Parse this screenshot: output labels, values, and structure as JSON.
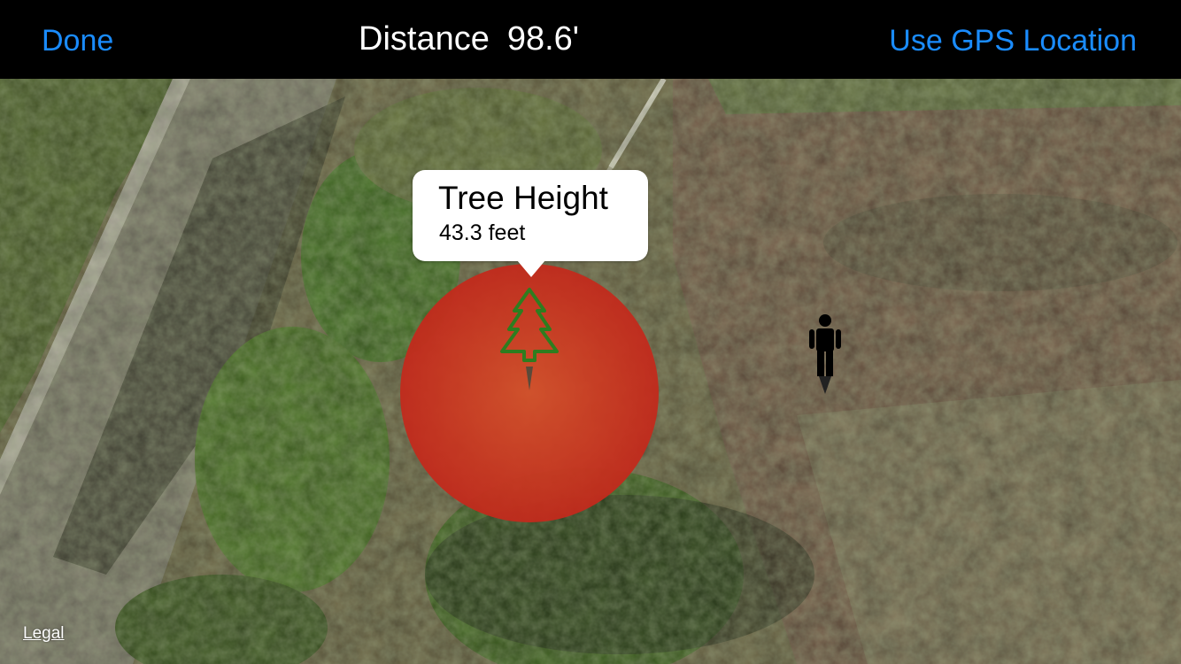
{
  "navbar": {
    "done_label": "Done",
    "title_prefix": "Distance",
    "distance_value": "98.6'",
    "gps_label": "Use GPS Location"
  },
  "callout": {
    "title": "Tree Height",
    "subtitle": "43.3 feet"
  },
  "map": {
    "legal_label": "Legal",
    "tree_marker_icon": "tree-pin-icon",
    "person_marker_icon": "person-pin-icon",
    "tree_radius_color": "#c8321f",
    "tree_icon_color": "#2e7d1f"
  },
  "colors": {
    "nav_background": "#000000",
    "nav_button": "#1a8cff",
    "nav_title": "#ffffff"
  }
}
